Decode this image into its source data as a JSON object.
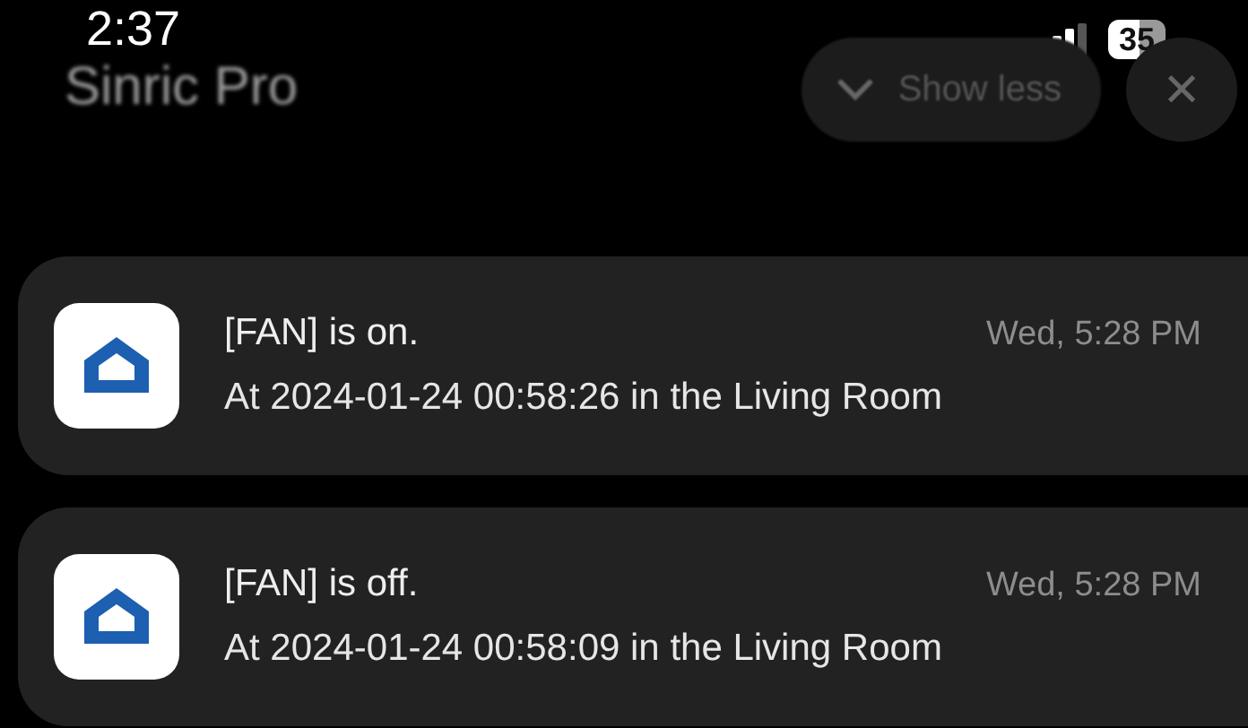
{
  "status_bar": {
    "time": "2:37",
    "battery": "35"
  },
  "header": {
    "app_name": "Sinric Pro",
    "show_less": "Show less",
    "close": "✕"
  },
  "notifications": [
    {
      "title": "[FAN] is on.",
      "time": "Wed, 5:28 PM",
      "body": "At 2024-01-24 00:58:26 in the Living Room"
    },
    {
      "title": "[FAN] is off.",
      "time": "Wed, 5:28 PM",
      "body": "At 2024-01-24 00:58:09 in the Living Room"
    }
  ]
}
